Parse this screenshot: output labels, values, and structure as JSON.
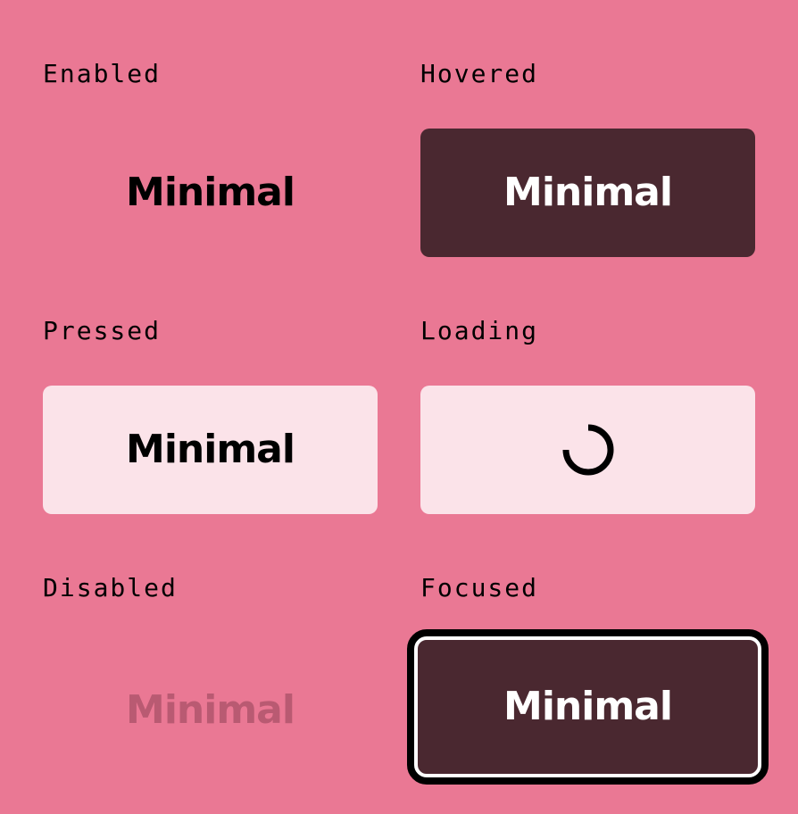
{
  "colors": {
    "background": "#ea7894",
    "dark_fill": "#4a2830",
    "light_fill": "#fbe3e9",
    "disabled_text": "#b95a72",
    "focus_outline": "#000000",
    "focus_inner_ring": "#ffffff"
  },
  "states": {
    "enabled": {
      "label": "Enabled",
      "button_text": "Minimal"
    },
    "hovered": {
      "label": "Hovered",
      "button_text": "Minimal"
    },
    "pressed": {
      "label": "Pressed",
      "button_text": "Minimal"
    },
    "loading": {
      "label": "Loading",
      "icon": "spinner-icon"
    },
    "disabled": {
      "label": "Disabled",
      "button_text": "Minimal"
    },
    "focused": {
      "label": "Focused",
      "button_text": "Minimal"
    }
  }
}
